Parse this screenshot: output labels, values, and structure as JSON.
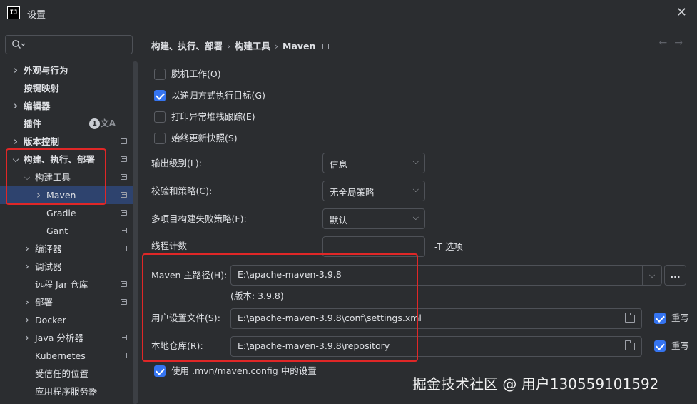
{
  "window": {
    "app_icon": "IJ",
    "title": "设置",
    "close_icon": "✕"
  },
  "sidebar": {
    "search": {
      "placeholder": ""
    },
    "items": [
      {
        "label": "外观与行为",
        "indent": 0,
        "chevron": "right",
        "bold": true
      },
      {
        "label": "按键映射",
        "indent": 0,
        "chevron": "none",
        "bold": true
      },
      {
        "label": "编辑器",
        "indent": 0,
        "chevron": "right",
        "bold": true
      },
      {
        "label": "插件",
        "indent": 0,
        "chevron": "none",
        "bold": true,
        "badge": "1"
      },
      {
        "label": "版本控制",
        "indent": 0,
        "chevron": "right",
        "bold": true,
        "icon": true
      },
      {
        "label": "构建、执行、部署",
        "indent": 0,
        "chevron": "down",
        "bold": true,
        "icon": true
      },
      {
        "label": "构建工具",
        "indent": 1,
        "chevron": "down",
        "bold": false,
        "icon": true
      },
      {
        "label": "Maven",
        "indent": 2,
        "chevron": "right",
        "bold": false,
        "icon": true,
        "selected": true
      },
      {
        "label": "Gradle",
        "indent": 2,
        "chevron": "none",
        "bold": false,
        "icon": true
      },
      {
        "label": "Gant",
        "indent": 2,
        "chevron": "none",
        "bold": false,
        "icon": true
      },
      {
        "label": "编译器",
        "indent": 1,
        "chevron": "right",
        "bold": false,
        "icon": true
      },
      {
        "label": "调试器",
        "indent": 1,
        "chevron": "right",
        "bold": false
      },
      {
        "label": "远程 Jar 仓库",
        "indent": 1,
        "chevron": "none",
        "bold": false,
        "icon": true
      },
      {
        "label": "部署",
        "indent": 1,
        "chevron": "right",
        "bold": false,
        "icon": true
      },
      {
        "label": "Docker",
        "indent": 1,
        "chevron": "right",
        "bold": false
      },
      {
        "label": "Java 分析器",
        "indent": 1,
        "chevron": "right",
        "bold": false,
        "icon": true
      },
      {
        "label": "Kubernetes",
        "indent": 1,
        "chevron": "none",
        "bold": false,
        "icon": true
      },
      {
        "label": "受信任的位置",
        "indent": 1,
        "chevron": "none",
        "bold": false
      },
      {
        "label": "应用程序服务器",
        "indent": 1,
        "chevron": "none",
        "bold": false
      }
    ]
  },
  "breadcrumb": {
    "part1": "构建、执行、部署",
    "sep": "›",
    "part2": "构建工具",
    "part3": "Maven"
  },
  "options": {
    "offline": {
      "label": "脱机工作(O)",
      "checked": false
    },
    "recursive": {
      "label": "以递归方式执行目标(G)",
      "checked": true
    },
    "print_stack": {
      "label": "打印异常堆栈跟踪(E)",
      "checked": false
    },
    "always_update": {
      "label": "始终更新快照(S)",
      "checked": false
    }
  },
  "form": {
    "output_level": {
      "label": "输出级别(L):",
      "value": "信息"
    },
    "checksum_policy": {
      "label": "校验和策略(C):",
      "value": "无全局策略"
    },
    "multiproject_fail": {
      "label": "多项目构建失败策略(F):",
      "value": "默认"
    },
    "thread_count": {
      "label": "线程计数",
      "value": "",
      "suffix": "-T 选项"
    },
    "maven_home": {
      "label": "Maven 主路径(H):",
      "value": "E:\\apache-maven-3.9.8",
      "browse": "..."
    },
    "version": "(版本: 3.9.8)",
    "user_settings": {
      "label": "用户设置文件(S):",
      "value": "E:\\apache-maven-3.9.8\\conf\\settings.xml",
      "override_label": "重写",
      "override_checked": true
    },
    "local_repo": {
      "label": "本地仓库(R):",
      "value": "E:\\apache-maven-3.9.8\\repository",
      "override_label": "重写",
      "override_checked": true
    },
    "use_mvn_config": {
      "label": "使用 .mvn/maven.config 中的设置",
      "checked": true
    }
  },
  "watermark": "掘金技术社区 @ 用户130559101592",
  "colors": {
    "background": "#2b2d30",
    "selection": "#2e436e",
    "checkbox_accent": "#3574f0",
    "highlight_box": "#e02727"
  }
}
